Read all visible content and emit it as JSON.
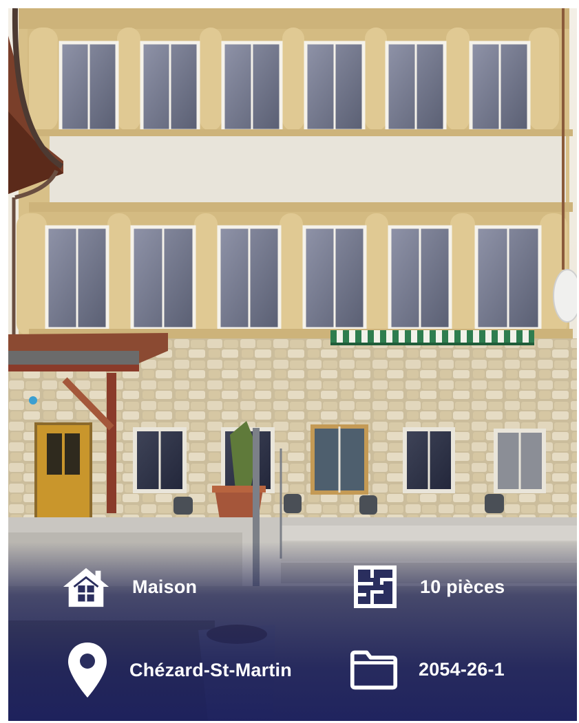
{
  "listing": {
    "property_type": "Maison",
    "rooms": "10 pièces",
    "location": "Chézard-St-Martin",
    "reference": "2054-26-1"
  },
  "icons": {
    "type": "house-icon",
    "rooms": "floor-plan-icon",
    "location": "map-pin-icon",
    "reference": "folder-icon"
  },
  "colors": {
    "overlay": "#1c2058",
    "text": "#ffffff",
    "facade_stone": "#d9c38c",
    "render_wall": "#e8e4da",
    "awning_green": "#2e7d4f"
  }
}
